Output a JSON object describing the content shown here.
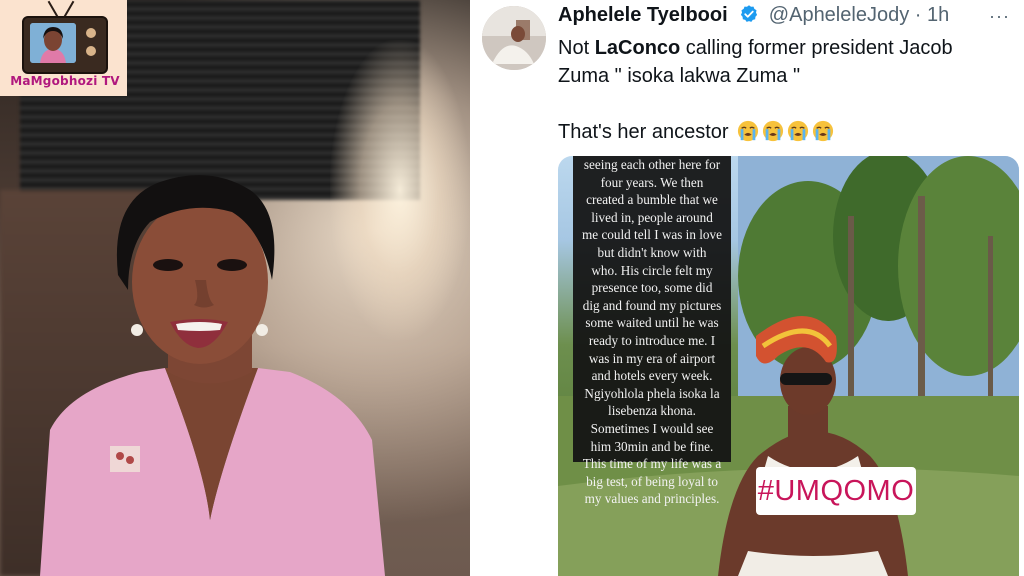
{
  "logo": {
    "text": "MaMgobhozi TV"
  },
  "tweet": {
    "display_name": "Aphelele Tyelbooi",
    "handle": "@ApheleleJody",
    "separator": "·",
    "time": "1h",
    "more_label": "···",
    "text_parts": [
      "Not ",
      "LaConco",
      " calling former president Jacob Zuma \" isoka lakwa Zuma \""
    ],
    "text_line2": "That's her ancestor",
    "emoji_name": "loudly-crying-face",
    "emoji_count": 4
  },
  "story": {
    "lines": [
      "seeing each other here for",
      "four years. We then",
      "created a bumble that we",
      "lived in, people around",
      "me could tell I was in love",
      "but didn't know with",
      "who. His circle felt my",
      "presence too, some did",
      "dig and found my pictures",
      "some waited until he was",
      "ready to introduce me. I",
      "was in my era of airport",
      "and hotels every week.",
      "Ngiyohlola phela isoka la",
      "lisebenza khona.",
      "Sometimes I would see",
      "him 30min and be fine.",
      "This time of my life was a",
      "big test, of being loyal to",
      "my values and principles."
    ],
    "hashtag": "#UMQOMO"
  },
  "colors": {
    "accent_blue": "#1d9bf0",
    "hashtag": "#c8155a",
    "logo_text": "#b0187e"
  }
}
